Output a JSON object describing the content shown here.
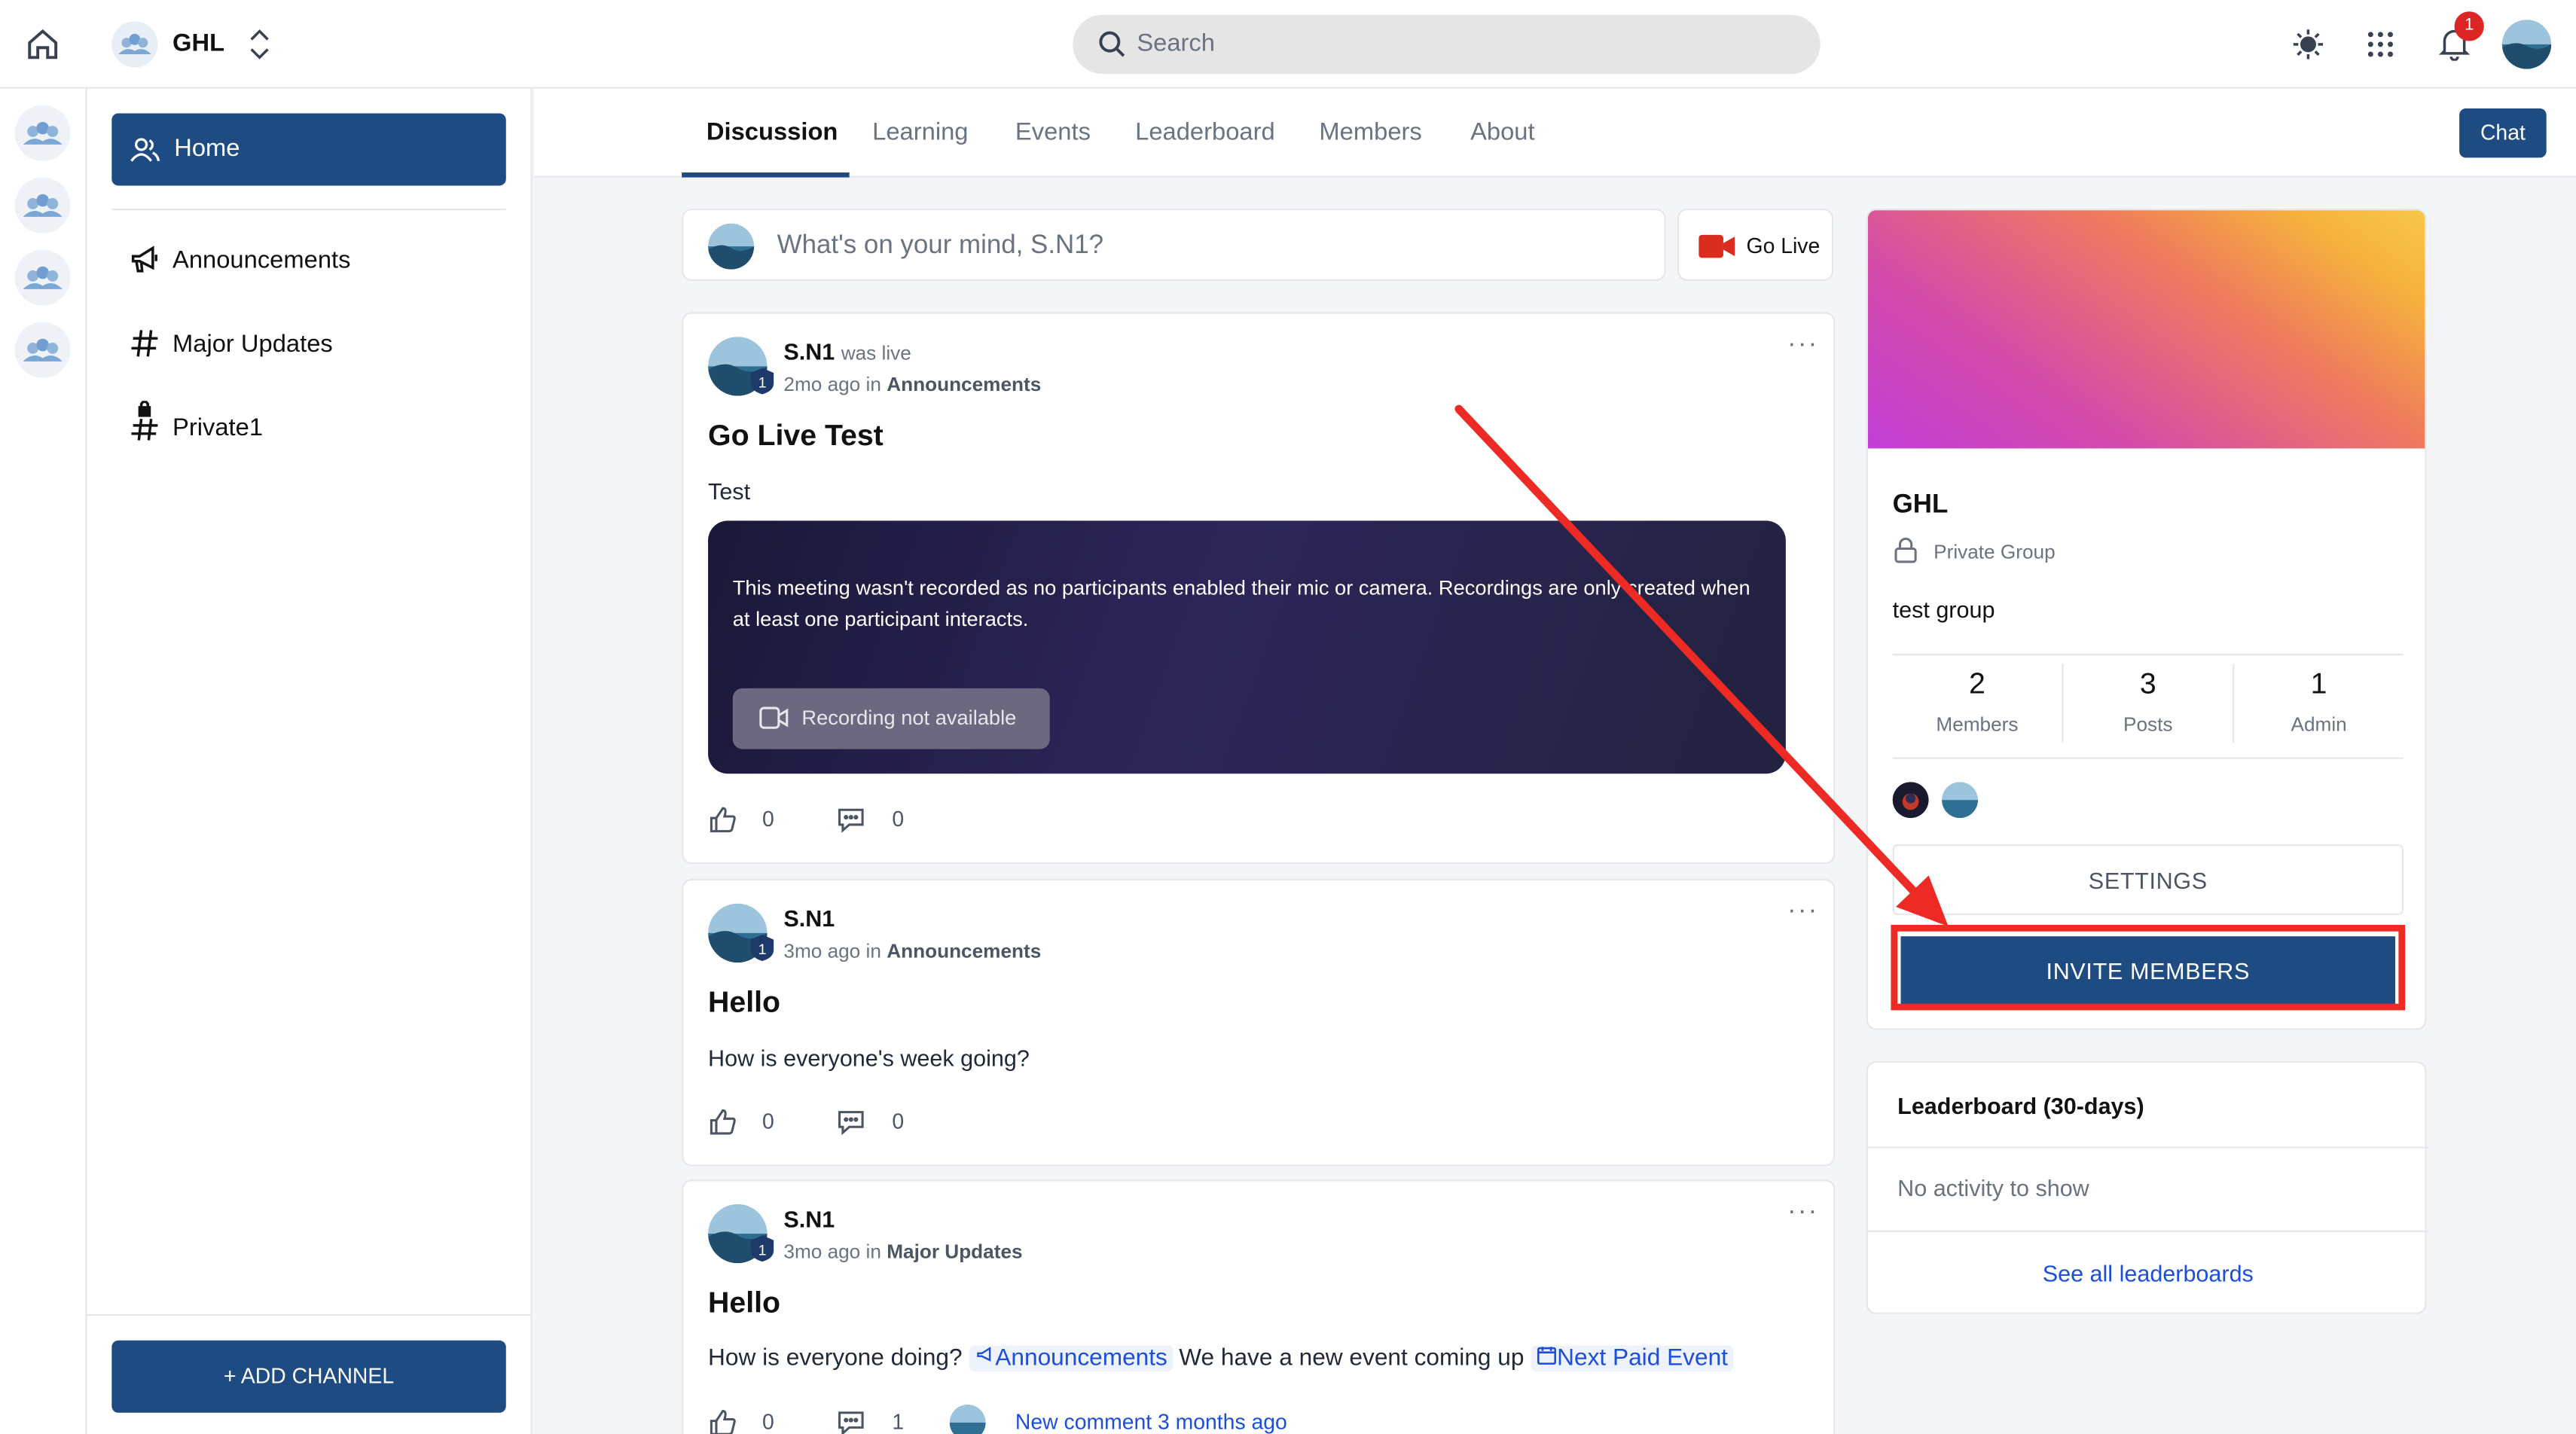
{
  "header": {
    "group_name": "GHL",
    "search_placeholder": "Search",
    "notification_count": "1"
  },
  "sidebar": {
    "items": [
      {
        "label": "Home",
        "icon": "user-group-icon",
        "active": true
      },
      {
        "label": "Announcements",
        "icon": "megaphone-icon"
      },
      {
        "label": "Major Updates",
        "icon": "hash-icon"
      },
      {
        "label": "Private1",
        "icon": "locked-hash-icon"
      }
    ],
    "add_channel_label": "+ ADD CHANNEL"
  },
  "tabs": [
    {
      "label": "Discussion",
      "active": true
    },
    {
      "label": "Learning"
    },
    {
      "label": "Events"
    },
    {
      "label": "Leaderboard"
    },
    {
      "label": "Members"
    },
    {
      "label": "About"
    }
  ],
  "chat_label": "Chat",
  "composer": {
    "placeholder": "What's on your mind, S.N1?",
    "go_live_label": "Go Live"
  },
  "posts": [
    {
      "author": "S.N1",
      "status": "was live",
      "time": "2mo ago",
      "in_label": "in",
      "channel": "Announcements",
      "title": "Go Live Test",
      "body": "Test",
      "recording_message": "This meeting wasn't recorded as no participants enabled their mic or camera. Recordings are only created when at least one participant interacts.",
      "recording_button": "Recording not available",
      "likes": "0",
      "comments": "0"
    },
    {
      "author": "S.N1",
      "time": "3mo ago",
      "in_label": "in",
      "channel": "Announcements",
      "title": "Hello",
      "body": "How is everyone's week going?",
      "likes": "0",
      "comments": "0"
    },
    {
      "author": "S.N1",
      "time": "3mo ago",
      "in_label": "in",
      "channel": "Major Updates",
      "title": "Hello",
      "body_part1": "How is everyone doing?",
      "body_chip1": "Announcements",
      "body_part2": "We have a new event coming up",
      "body_chip2": "Next Paid Event",
      "likes": "0",
      "comments": "1",
      "new_comment": "New comment 3 months ago"
    }
  ],
  "group_card": {
    "name": "GHL",
    "privacy": "Private Group",
    "description": "test group",
    "stats": [
      {
        "value": "2",
        "label": "Members"
      },
      {
        "value": "3",
        "label": "Posts"
      },
      {
        "value": "1",
        "label": "Admin"
      }
    ],
    "settings_label": "SETTINGS",
    "invite_label": "INVITE MEMBERS"
  },
  "leaderboard": {
    "title": "Leaderboard (30-days)",
    "empty_text": "No activity to show",
    "link_label": "See all leaderboards"
  },
  "colors": {
    "primary": "#1e4b82",
    "highlight": "#ee2a24",
    "link": "#1d4ed8"
  }
}
